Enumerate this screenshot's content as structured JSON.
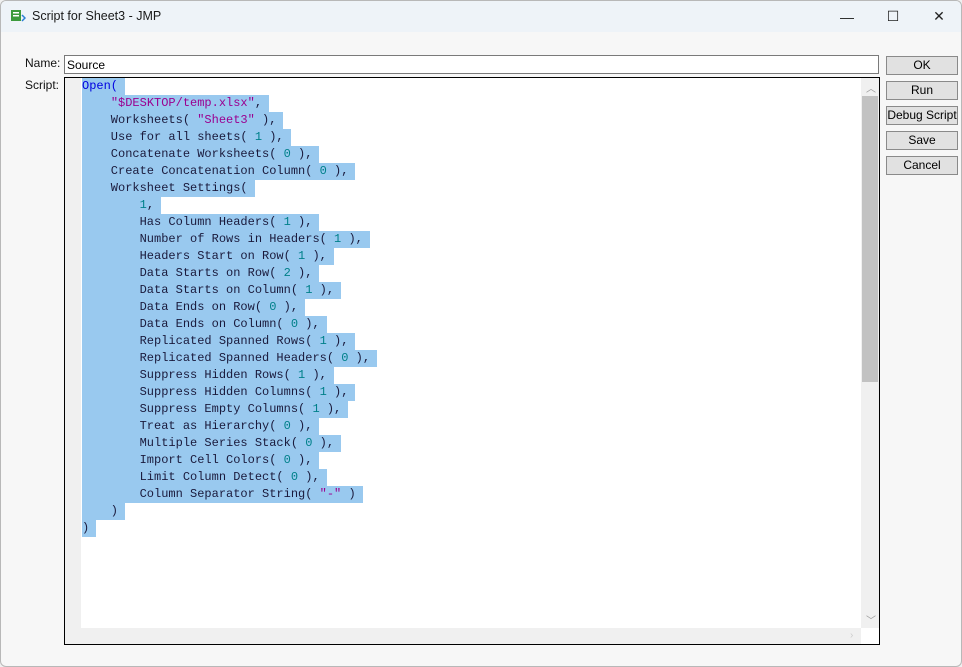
{
  "window": {
    "title": "Script for Sheet3 - JMP",
    "minimize": "—",
    "maximize": "☐",
    "close": "✕"
  },
  "form": {
    "name_label": "Name:",
    "name_value": "Source",
    "script_label": "Script:"
  },
  "buttons": {
    "ok": "OK",
    "run": "Run",
    "debug": "Debug Script",
    "save": "Save",
    "cancel": "Cancel"
  },
  "script_lines": [
    [
      [
        "kw",
        "Open("
      ]
    ],
    [
      [
        "pl",
        "    "
      ],
      [
        "str",
        "\"$DESKTOP/temp.xlsx\""
      ],
      [
        "pl",
        ","
      ]
    ],
    [
      [
        "pl",
        "    Worksheets( "
      ],
      [
        "str",
        "\"Sheet3\""
      ],
      [
        "pl",
        " ),"
      ]
    ],
    [
      [
        "pl",
        "    Use for all sheets( "
      ],
      [
        "num",
        "1"
      ],
      [
        "pl",
        " ),"
      ]
    ],
    [
      [
        "pl",
        "    Concatenate Worksheets( "
      ],
      [
        "num",
        "0"
      ],
      [
        "pl",
        " ),"
      ]
    ],
    [
      [
        "pl",
        "    Create Concatenation Column( "
      ],
      [
        "num",
        "0"
      ],
      [
        "pl",
        " ),"
      ]
    ],
    [
      [
        "pl",
        "    Worksheet Settings("
      ]
    ],
    [
      [
        "pl",
        "        "
      ],
      [
        "num",
        "1"
      ],
      [
        "pl",
        ","
      ]
    ],
    [
      [
        "pl",
        "        Has Column Headers( "
      ],
      [
        "num",
        "1"
      ],
      [
        "pl",
        " ),"
      ]
    ],
    [
      [
        "pl",
        "        Number of Rows in Headers( "
      ],
      [
        "num",
        "1"
      ],
      [
        "pl",
        " ),"
      ]
    ],
    [
      [
        "pl",
        "        Headers Start on Row( "
      ],
      [
        "num",
        "1"
      ],
      [
        "pl",
        " ),"
      ]
    ],
    [
      [
        "pl",
        "        Data Starts on Row( "
      ],
      [
        "num",
        "2"
      ],
      [
        "pl",
        " ),"
      ]
    ],
    [
      [
        "pl",
        "        Data Starts on Column( "
      ],
      [
        "num",
        "1"
      ],
      [
        "pl",
        " ),"
      ]
    ],
    [
      [
        "pl",
        "        Data Ends on Row( "
      ],
      [
        "num",
        "0"
      ],
      [
        "pl",
        " ),"
      ]
    ],
    [
      [
        "pl",
        "        Data Ends on Column( "
      ],
      [
        "num",
        "0"
      ],
      [
        "pl",
        " ),"
      ]
    ],
    [
      [
        "pl",
        "        Replicated Spanned Rows( "
      ],
      [
        "num",
        "1"
      ],
      [
        "pl",
        " ),"
      ]
    ],
    [
      [
        "pl",
        "        Replicated Spanned Headers( "
      ],
      [
        "num",
        "0"
      ],
      [
        "pl",
        " ),"
      ]
    ],
    [
      [
        "pl",
        "        Suppress Hidden Rows( "
      ],
      [
        "num",
        "1"
      ],
      [
        "pl",
        " ),"
      ]
    ],
    [
      [
        "pl",
        "        Suppress Hidden Columns( "
      ],
      [
        "num",
        "1"
      ],
      [
        "pl",
        " ),"
      ]
    ],
    [
      [
        "pl",
        "        Suppress Empty Columns( "
      ],
      [
        "num",
        "1"
      ],
      [
        "pl",
        " ),"
      ]
    ],
    [
      [
        "pl",
        "        Treat as Hierarchy( "
      ],
      [
        "num",
        "0"
      ],
      [
        "pl",
        " ),"
      ]
    ],
    [
      [
        "pl",
        "        Multiple Series Stack( "
      ],
      [
        "num",
        "0"
      ],
      [
        "pl",
        " ),"
      ]
    ],
    [
      [
        "pl",
        "        Import Cell Colors( "
      ],
      [
        "num",
        "0"
      ],
      [
        "pl",
        " ),"
      ]
    ],
    [
      [
        "pl",
        "        Limit Column Detect( "
      ],
      [
        "num",
        "0"
      ],
      [
        "pl",
        " ),"
      ]
    ],
    [
      [
        "pl",
        "        Column Separator String( "
      ],
      [
        "str",
        "\"-\""
      ],
      [
        "pl",
        " )"
      ]
    ],
    [
      [
        "pl",
        "    )"
      ]
    ],
    [
      [
        "pl",
        ")"
      ]
    ]
  ]
}
